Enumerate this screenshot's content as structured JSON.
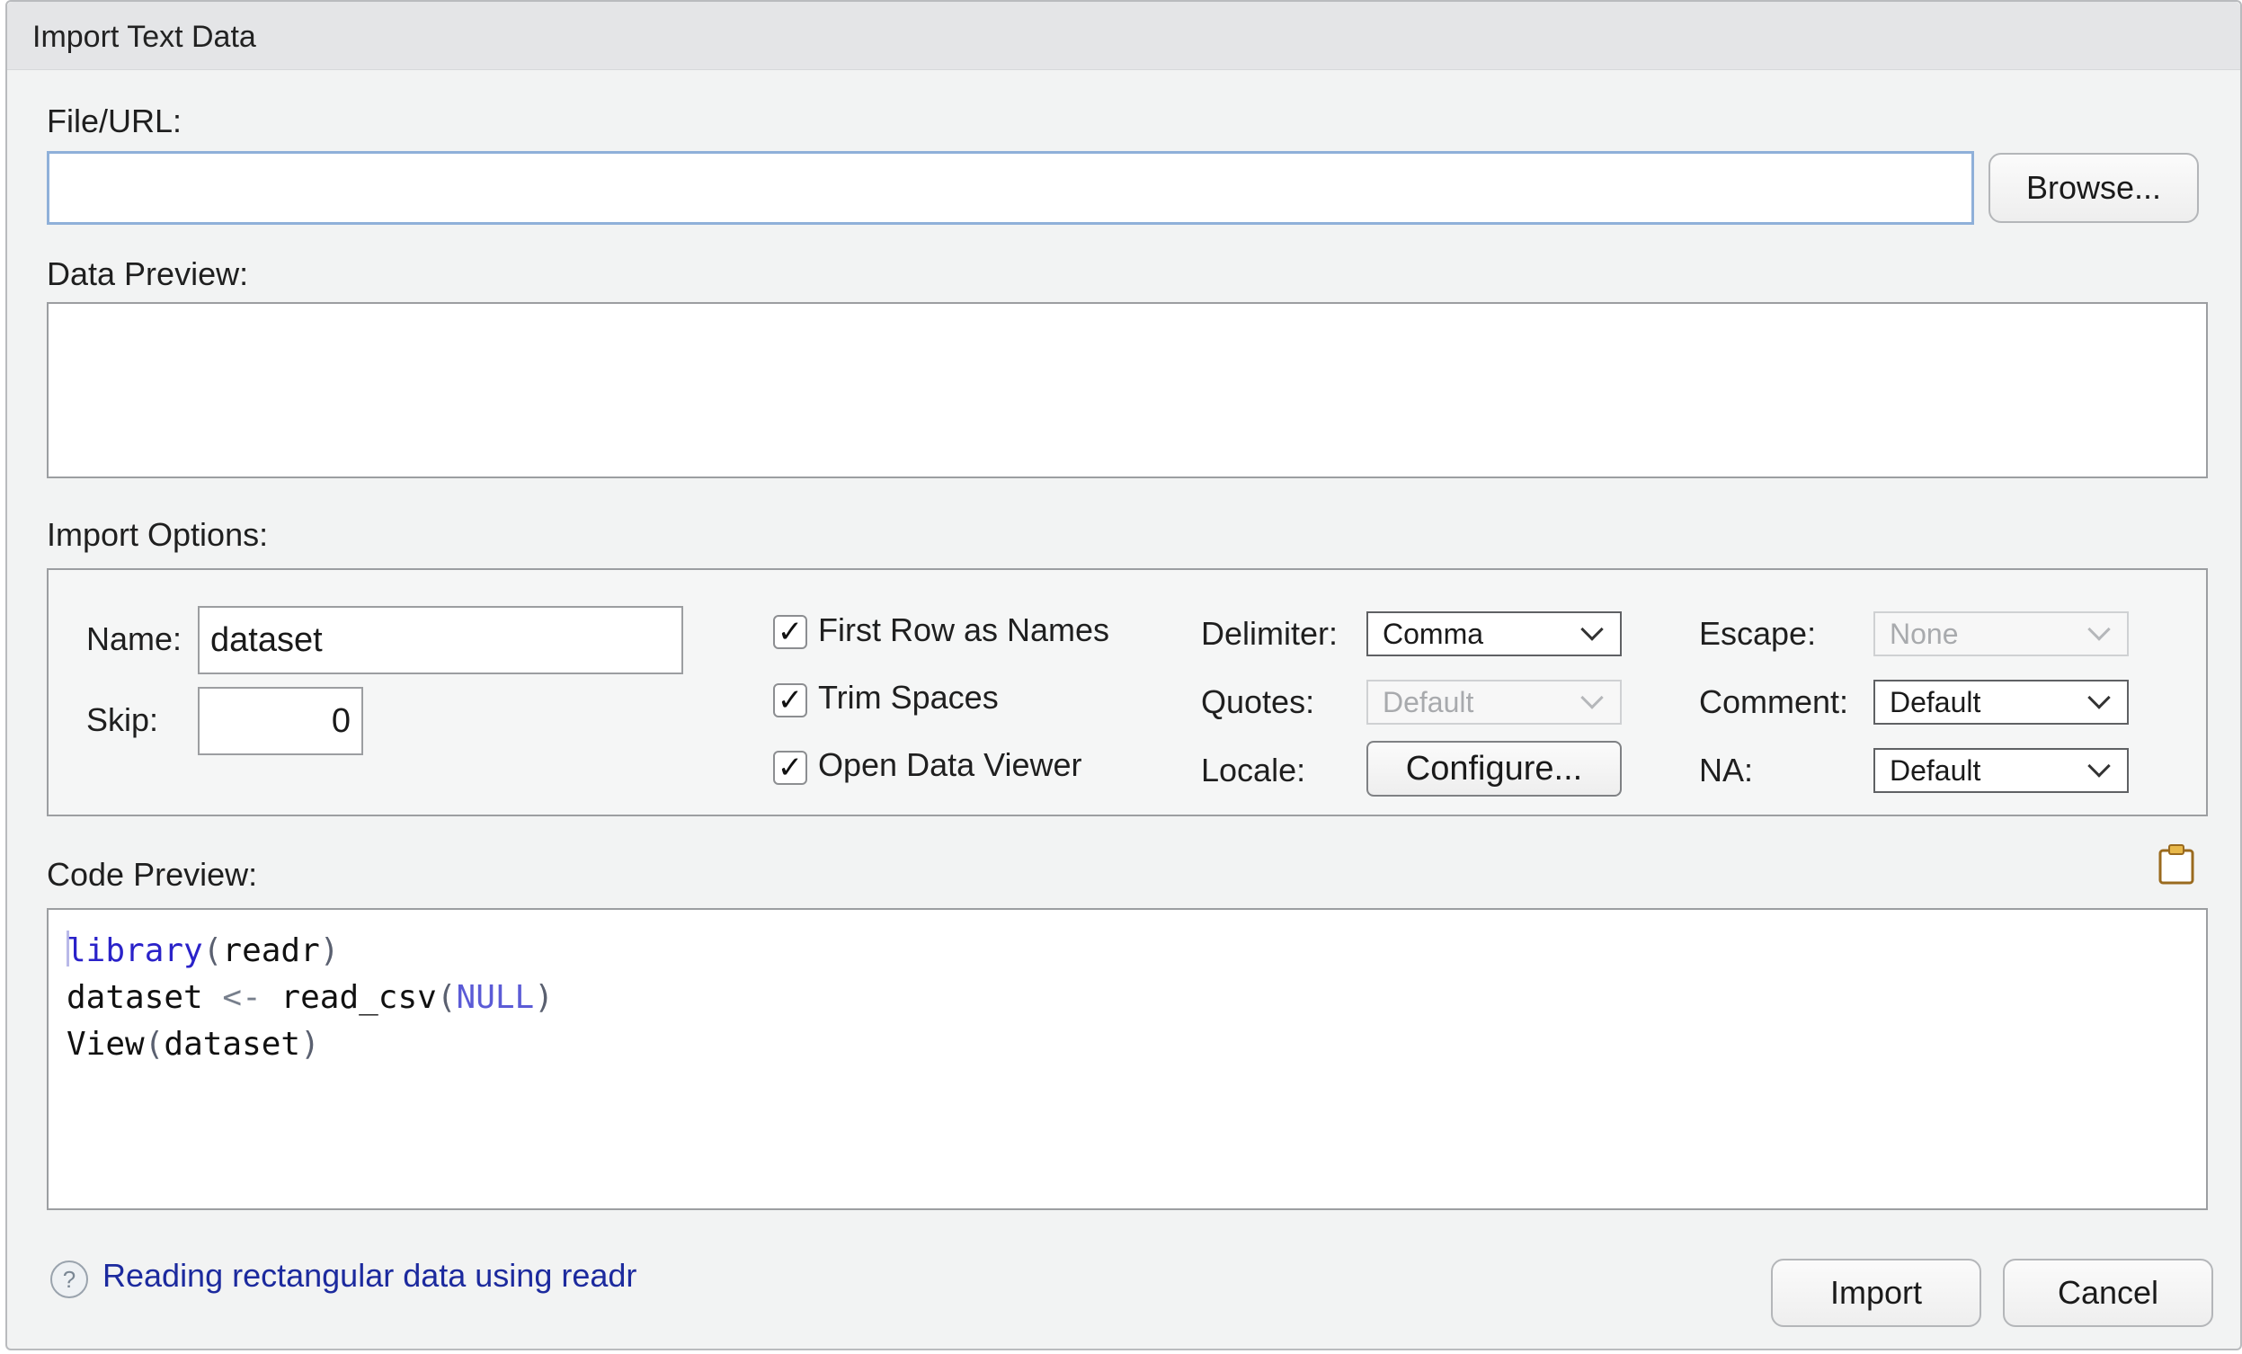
{
  "window": {
    "title": "Import Text Data"
  },
  "file": {
    "label": "File/URL:",
    "value": "",
    "placeholder": "",
    "browse_label": "Browse..."
  },
  "data_preview": {
    "label": "Data Preview:"
  },
  "options": {
    "label": "Import Options:",
    "name_label": "Name:",
    "name_value": "dataset",
    "skip_label": "Skip:",
    "skip_value": "0",
    "checkboxes": [
      {
        "label": "First Row as Names",
        "checked": true
      },
      {
        "label": "Trim Spaces",
        "checked": true
      },
      {
        "label": "Open Data Viewer",
        "checked": true
      }
    ],
    "delimiter_label": "Delimiter:",
    "delimiter_value": "Comma",
    "quotes_label": "Quotes:",
    "quotes_value": "Default",
    "locale_label": "Locale:",
    "configure_label": "Configure...",
    "escape_label": "Escape:",
    "escape_value": "None",
    "comment_label": "Comment:",
    "comment_value": "Default",
    "na_label": "NA:",
    "na_value": "Default"
  },
  "code_preview": {
    "label": "Code Preview:",
    "line1": {
      "fn": "library",
      "open": "(",
      "arg": "readr",
      "close": ")"
    },
    "line2": {
      "var": "dataset ",
      "assign": "<-",
      "fn": " read_csv",
      "open": "(",
      "arg": "NULL",
      "close": ")"
    },
    "line3": {
      "fn": "View",
      "open": "(",
      "arg": "dataset",
      "close": ")"
    }
  },
  "footer": {
    "help_icon": "?",
    "help_link": "Reading rectangular data using readr",
    "import_label": "Import",
    "cancel_label": "Cancel"
  },
  "icons": {
    "check": "✓",
    "clipboard": "clipboard-icon"
  }
}
